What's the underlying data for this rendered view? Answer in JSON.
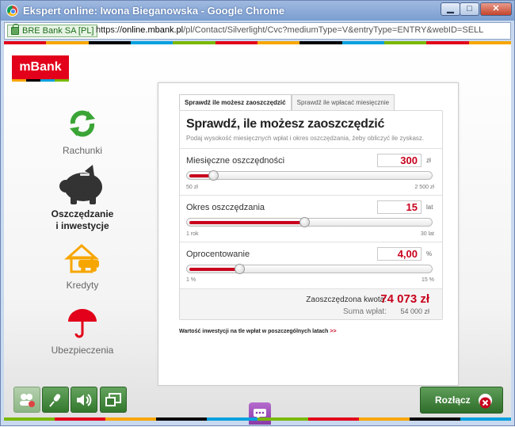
{
  "window": {
    "title": "Ekspert online: Iwona Bieganowska - Google Chrome",
    "min_label": "▁",
    "max_label": "□",
    "close_label": "✕"
  },
  "address": {
    "cert": "BRE Bank SA [PL]",
    "scheme": "https://",
    "host": "online.mbank.pl",
    "path": "/pl/Contact/Silverlight/Cvc?mediumType=V&entryType=ENTRY&webID=SELL"
  },
  "brand": {
    "logo": "mBank",
    "accent": "#c8001c"
  },
  "nav": [
    {
      "label": "Rachunki",
      "icon": "recycle-arrows-icon"
    },
    {
      "label1": "Oszczędzanie",
      "label2": "i inwestycje",
      "icon": "piggy-bank-icon"
    },
    {
      "label": "Kredyty",
      "icon": "house-car-icon"
    },
    {
      "label": "Ubezpieczenia",
      "icon": "umbrella-icon"
    }
  ],
  "tabs": [
    "Sprawdź ile możesz zaoszczędzić",
    "Sprawdź ile wpłacać miesięcznie"
  ],
  "calc": {
    "title": "Sprawdź, ile możesz zaoszczędzić",
    "subtitle": "Podaj wysokość miesięcznych wpłat i okres oszczędzania, żeby obliczyć ile zyskasz.",
    "fields": [
      {
        "label": "Miesięczne oszczędności",
        "value": "300",
        "unit": "zł",
        "min": "50 zł",
        "max": "2 500 zł",
        "level": 0.1
      },
      {
        "label": "Okres oszczędzania",
        "value": "15",
        "unit": "lat",
        "min": "1 rok",
        "max": "30 lat",
        "level": 0.48
      },
      {
        "label": "Oprocentowanie",
        "value": "4,00",
        "unit": "%",
        "min": "1 %",
        "max": "15 %",
        "level": 0.21
      }
    ],
    "saved_label": "Zaoszczędzona kwota:",
    "saved_value": "74 073 zł",
    "paid_label": "Suma wpłat:",
    "paid_value": "54 000 zł"
  },
  "link": {
    "text": "Wartość inwestycji na tle wpłat w poszczególnych latach",
    "arrow": ">>"
  },
  "controls": {
    "hangup": "Rozłącz"
  }
}
